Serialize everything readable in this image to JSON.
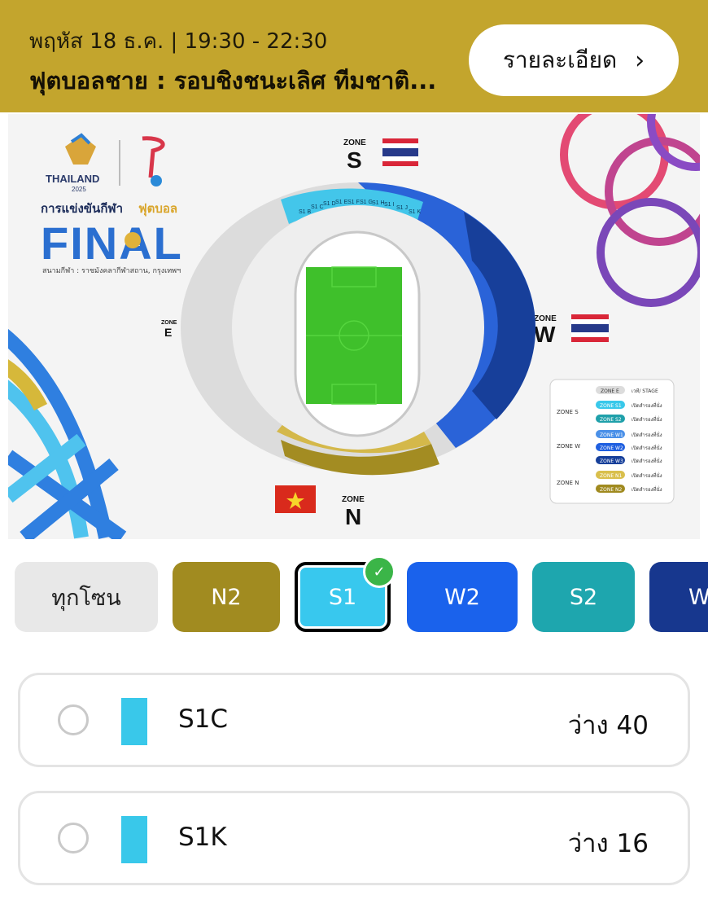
{
  "header": {
    "datetime": "พฤหัส 18 ธ.ค.  |  19:30 - 22:30",
    "title": "ฟุตบอลชาย : รอบชิงชนะเลิศ ทีมชาติ...",
    "details_label": "รายละเอียด",
    "details_icon": "chevron-right-icon"
  },
  "event_poster": {
    "brand": "THAILAND",
    "brand_year": "2025",
    "competition": "การแข่งขันกีฬา",
    "sport": "ฟุตบอล",
    "headline": "FINAL",
    "venue": "สนามกีฬา : ราชมังคลากีฬาสถาน, กรุงเทพฯ",
    "zones": {
      "s": {
        "word": "ZONE",
        "letter": "S"
      },
      "n": {
        "word": "ZONE",
        "letter": "N"
      },
      "e": {
        "word": "ZONE",
        "letter": "E"
      },
      "w": {
        "word": "ZONE",
        "letter": "W"
      }
    },
    "s1_sections": [
      "S1 B",
      "S1 C",
      "S1 D",
      "S1 E",
      "S1 F",
      "S1 G",
      "S1 H",
      "S1 I",
      "S1 J",
      "S1 K"
    ],
    "legend": {
      "zone_e": {
        "chip": "ZONE E",
        "text": "เวที/ STAGE"
      },
      "groups": [
        {
          "label": "ZONE S",
          "items": [
            {
              "chip": "ZONE S1",
              "text": "เปิดสำรองที่นั่ง",
              "color": "#39c8ea"
            },
            {
              "chip": "ZONE S2",
              "text": "เปิดสำรองที่นั่ง",
              "color": "#1fa0aa"
            }
          ]
        },
        {
          "label": "ZONE W",
          "items": [
            {
              "chip": "ZONE W1",
              "text": "เปิดสำรองที่นั่ง",
              "color": "#4a90e8"
            },
            {
              "chip": "ZONE W2",
              "text": "เปิดสำรองที่นั่ง",
              "color": "#1f5fe0"
            },
            {
              "chip": "ZONE W3",
              "text": "เปิดสำรองที่นั่ง",
              "color": "#163f9a"
            }
          ]
        },
        {
          "label": "ZONE N",
          "items": [
            {
              "chip": "ZONE N1",
              "text": "เปิดสำรองที่นั่ง",
              "color": "#d9bf4c"
            },
            {
              "chip": "ZONE N2",
              "text": "เปิดสำรองที่นั่ง",
              "color": "#a08a1f"
            }
          ]
        }
      ]
    }
  },
  "zone_filters": [
    {
      "label": "ทุกโซน",
      "selected": false,
      "bg": "#e8e8e8",
      "fg": "#222222"
    },
    {
      "label": "N2",
      "selected": false,
      "bg": "#a18b20",
      "fg": "#ffffff"
    },
    {
      "label": "S1",
      "selected": true,
      "bg": "#38c8ee",
      "fg": "#ffffff"
    },
    {
      "label": "W2",
      "selected": false,
      "bg": "#1a62ec",
      "fg": "#ffffff"
    },
    {
      "label": "S2",
      "selected": false,
      "bg": "#1ea6ae",
      "fg": "#ffffff"
    },
    {
      "label": "W",
      "selected": false,
      "bg": "#17378e",
      "fg": "#ffffff"
    }
  ],
  "sections": [
    {
      "name": "S1C",
      "availability": "ว่าง 40",
      "color": "#39c8ea"
    },
    {
      "name": "S1K",
      "availability": "ว่าง 16",
      "color": "#39c8ea"
    }
  ],
  "colors": {
    "header_bg": "#c3a52d",
    "selected_border": "#000000",
    "check_green": "#3bb548",
    "pitch_green": "#3fc02b"
  }
}
